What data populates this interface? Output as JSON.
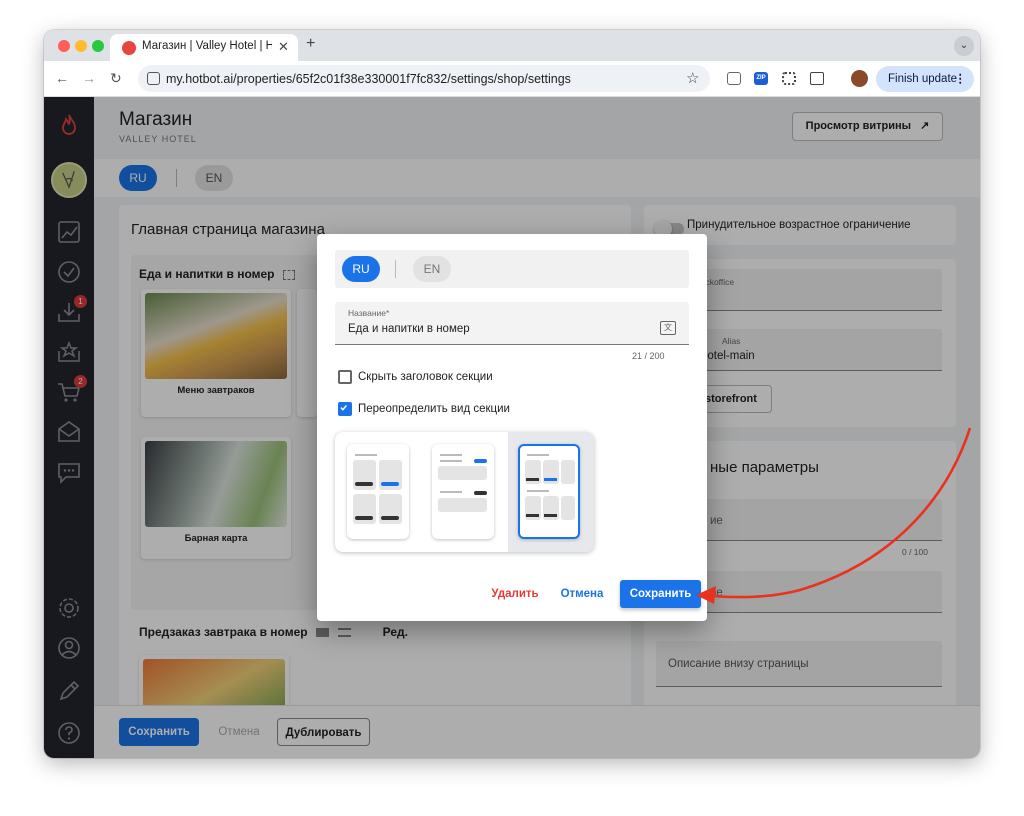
{
  "browser": {
    "tab_title": "Магазин | Valley Hotel | Hotbot",
    "url": "my.hotbot.ai/properties/65f2c01f38e330001f7fc832/settings/shop/settings",
    "finish_update_label": "Finish update",
    "ext_zip_label": "ZIP"
  },
  "sidebar": {
    "badges": {
      "inbox": "1",
      "cart": "2"
    }
  },
  "header": {
    "title": "Магазин",
    "subtitle": "VALLEY HOTEL",
    "preview_button": "Просмотр витрины",
    "preview_icon": "↗"
  },
  "languages": {
    "ru": "RU",
    "en": "EN"
  },
  "left_panel": {
    "title": "Главная страница магазина",
    "section1_title": "Еда и напитки в номер",
    "cards": [
      {
        "label": "Меню завтраков"
      },
      {
        "label": "Барная карта"
      }
    ],
    "section2_title": "Предзаказ завтрака в номер",
    "section2_edit": "Ред."
  },
  "right_panel": {
    "age_restriction": "Принудительное возрастное ограничение",
    "backoffice_label": "backoffice",
    "alias_label": "Alias",
    "alias_value": "hotel-main",
    "storefront_button": "storefront",
    "extra_title": "ные параметры",
    "field_partial_1": "ие",
    "counter_2": "0 / 100",
    "field_partial_2": "ие",
    "bottom_description": "Описание внизу страницы"
  },
  "footer": {
    "save": "Сохранить",
    "cancel": "Отмена",
    "duplicate": "Дублировать"
  },
  "dialog": {
    "name_label": "Название*",
    "name_value": "Еда и напитки в номер",
    "counter": "21 / 200",
    "hide_header_label": "Скрыть заголовок секции",
    "override_view_label": "Переопределить вид секции",
    "delete_button": "Удалить",
    "cancel_button": "Отмена",
    "save_button": "Сохранить"
  },
  "colors": {
    "accent": "#1a73e8",
    "danger": "#e53935",
    "sidebar": "#22262d",
    "annotation_arrow": "#e8321e"
  }
}
